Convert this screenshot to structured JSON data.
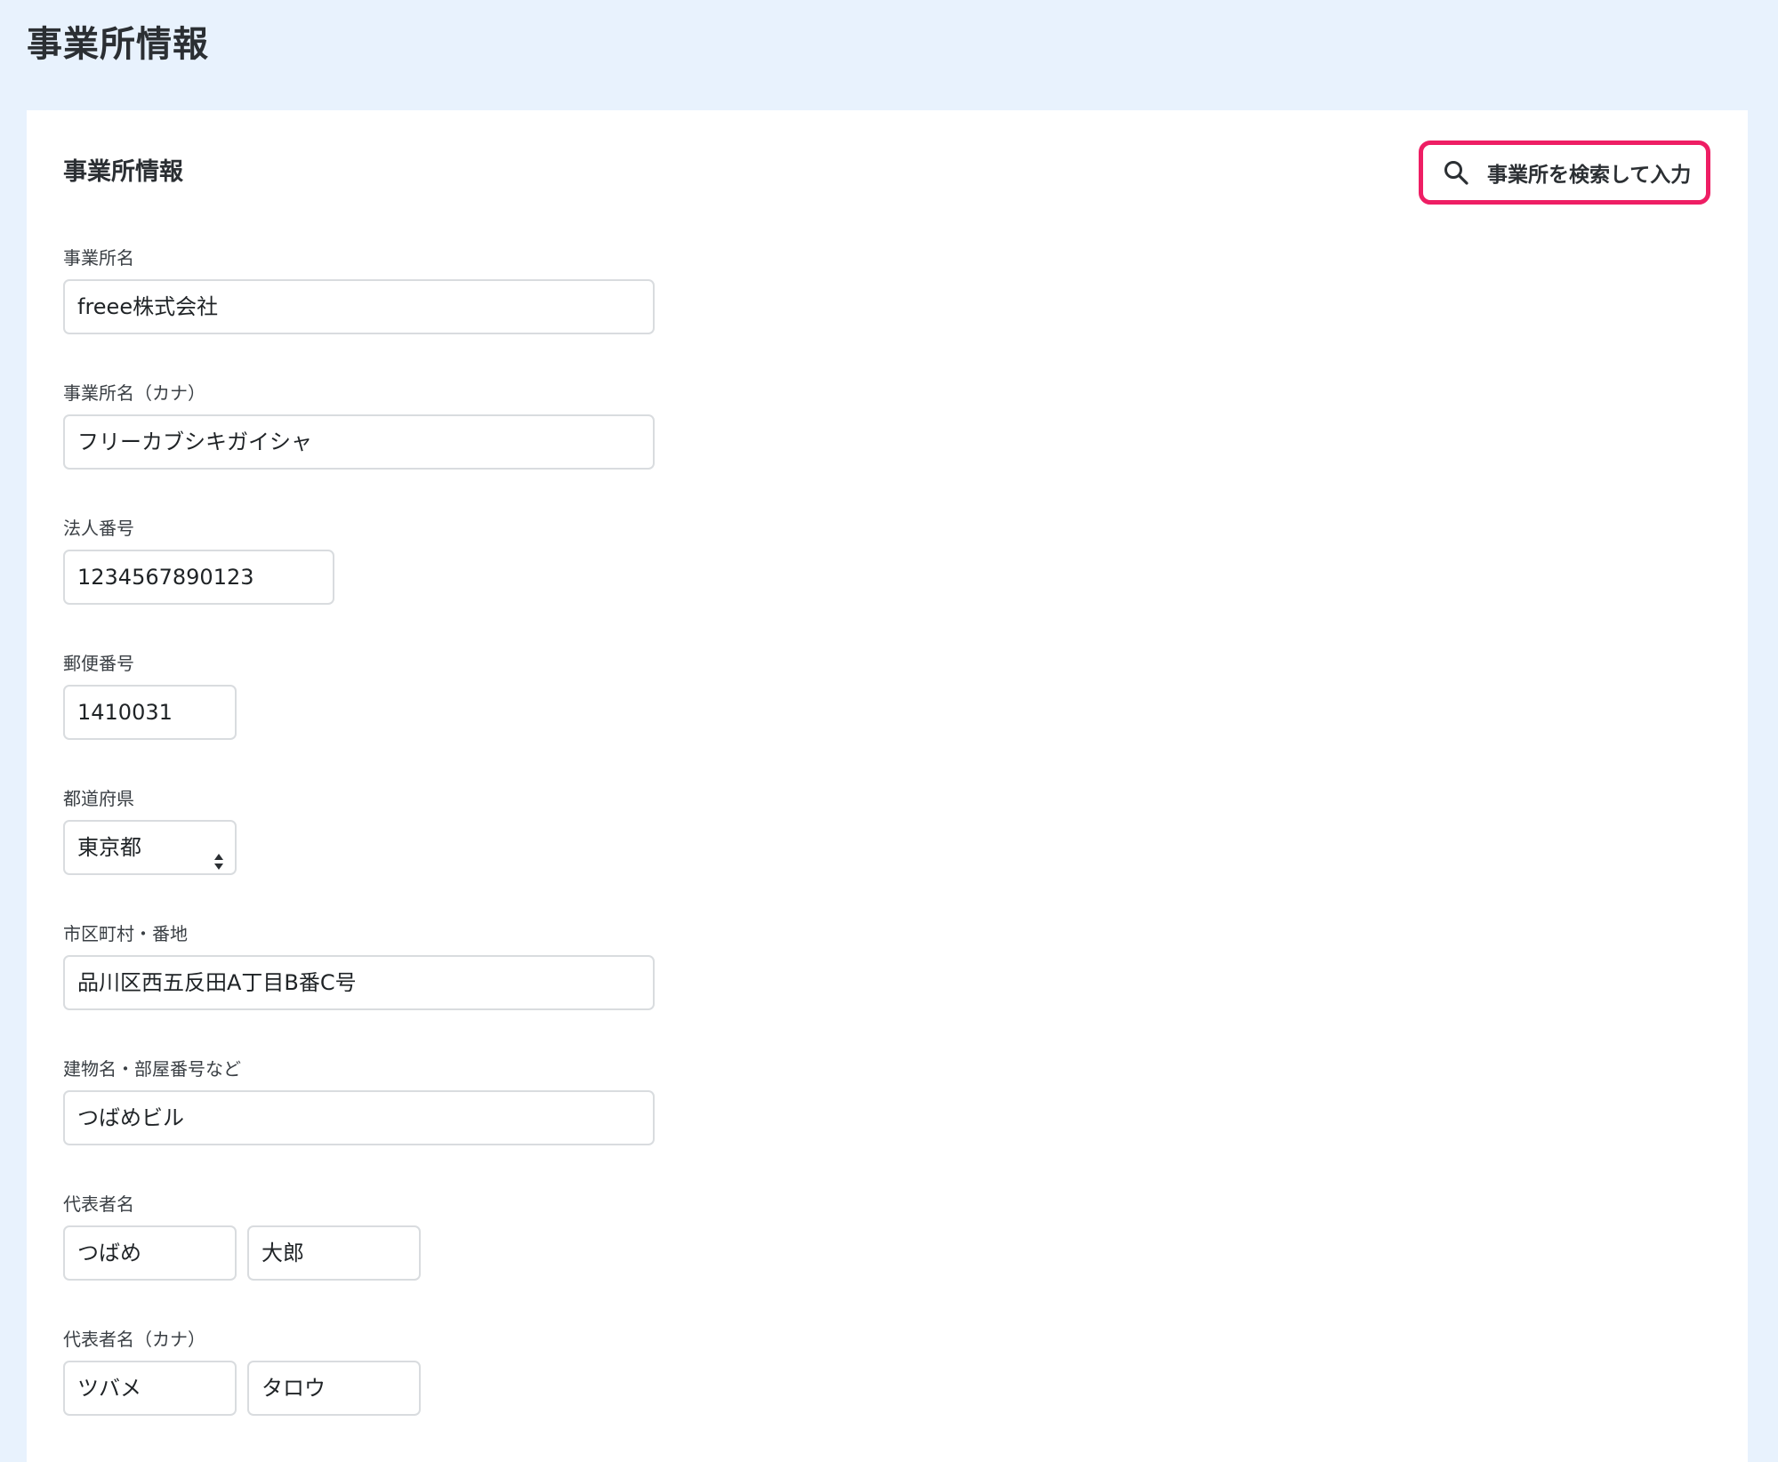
{
  "page": {
    "title": "事業所情報"
  },
  "section": {
    "title": "事業所情報",
    "search_button": {
      "label": "事業所を検索して入力",
      "icon": "search-icon",
      "highlight_color": "#ee1e64"
    }
  },
  "fields": {
    "office_name": {
      "label": "事業所名",
      "value": "freee株式会社"
    },
    "office_name_kana": {
      "label": "事業所名（カナ）",
      "value": "フリーカブシキガイシャ"
    },
    "corporate_number": {
      "label": "法人番号",
      "value": "1234567890123"
    },
    "postal_code": {
      "label": "郵便番号",
      "value": "1410031"
    },
    "prefecture": {
      "label": "都道府県",
      "value": "東京都",
      "icon": "select-arrows-icon"
    },
    "city_address": {
      "label": "市区町村・番地",
      "value": "品川区西五反田A丁目B番C号"
    },
    "building": {
      "label": "建物名・部屋番号など",
      "value": "つばめビル"
    },
    "representative": {
      "label": "代表者名",
      "last_name": "つばめ",
      "first_name": "大郎"
    },
    "representative_kana": {
      "label": "代表者名（カナ）",
      "last_name": "ツバメ",
      "first_name": "タロウ"
    }
  },
  "colors": {
    "background": "#e8f2fd",
    "panel": "#ffffff",
    "input_border": "#d9dcdf"
  }
}
